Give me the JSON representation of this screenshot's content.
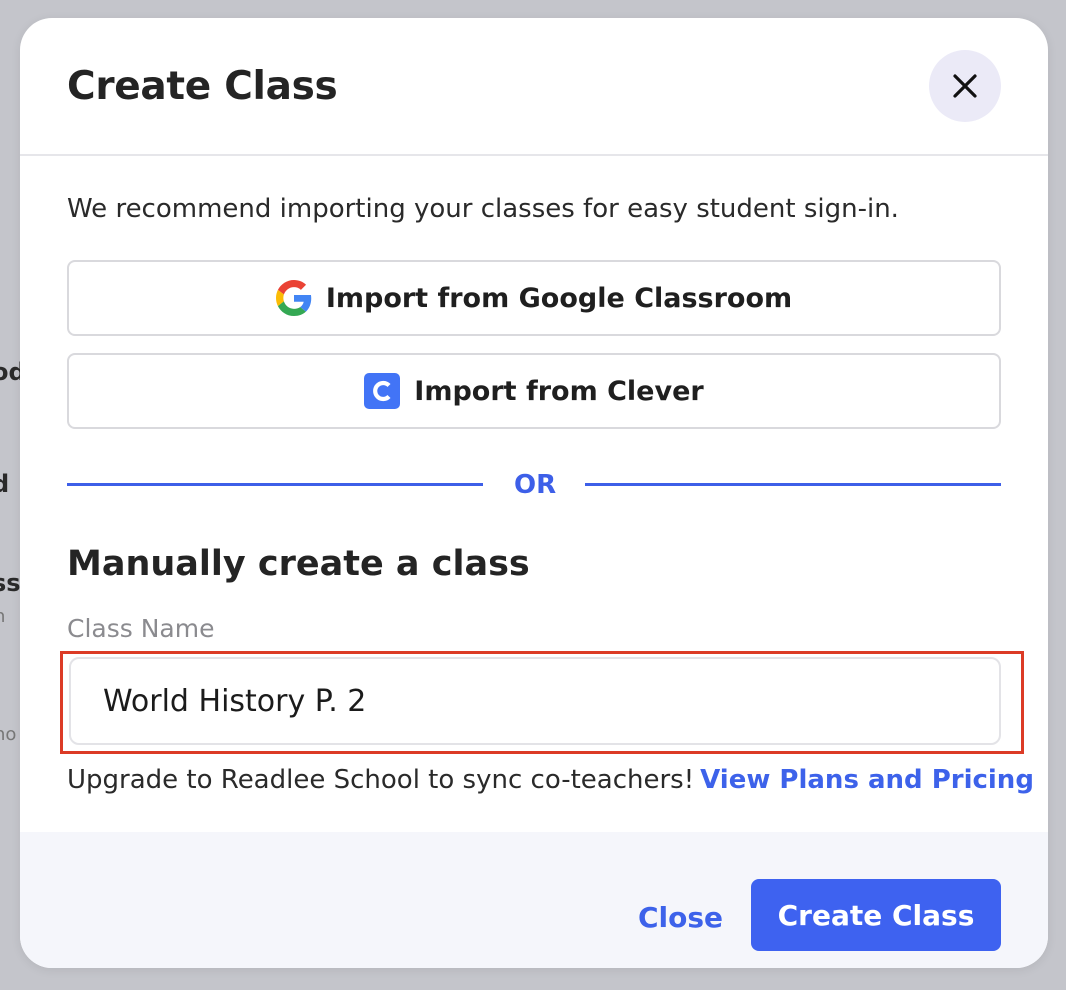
{
  "background": {
    "fragments": [
      "od",
      "d",
      "ss",
      "n",
      "no"
    ]
  },
  "modal": {
    "title": "Create Class",
    "recommend_text": "We recommend importing your classes for easy student sign-in.",
    "google_button": "Import from Google Classroom",
    "clever_button": "Import from Clever",
    "or_divider": "OR",
    "manual_title": "Manually create a class",
    "class_name_label": "Class Name",
    "class_name_value": "World History P. 2",
    "upgrade_text": "Upgrade to Readlee School to sync co-teachers!",
    "upgrade_link": "View Plans and Pricing",
    "footer": {
      "close_label": "Close",
      "create_label": "Create Class"
    }
  },
  "colors": {
    "accent": "#3e62f0",
    "highlight_border": "#dc3b26",
    "clever_brand": "#4274f6"
  }
}
